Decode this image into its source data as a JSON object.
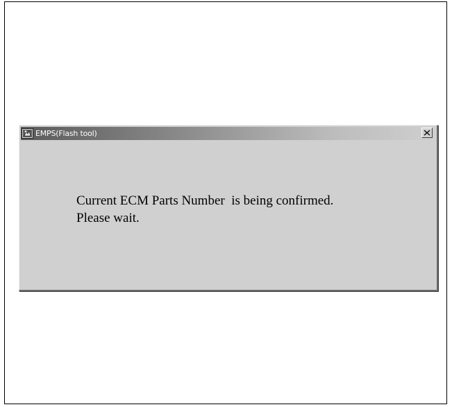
{
  "window": {
    "title": "EMPS(Flash tool)",
    "icon": "emps-app-icon",
    "close_icon": "close-x-icon"
  },
  "message": {
    "line1": "Current ECM Parts Number  is being confirmed.",
    "line2": "Please wait."
  }
}
